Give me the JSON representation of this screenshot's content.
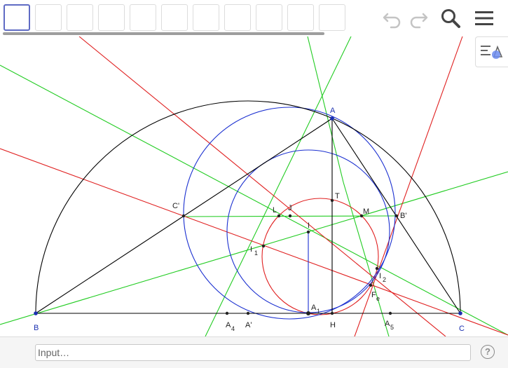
{
  "toolbar": {
    "tool_count": 11,
    "icons": [
      "undo-icon",
      "redo-icon",
      "search-icon",
      "menu-icon"
    ]
  },
  "style_bar": {
    "icon": "style-bar-icon"
  },
  "colors": {
    "black_lines": "#000000",
    "blue_circles": "#1a2fd0",
    "red_lines": "#e02020",
    "green_lines": "#22cc22",
    "point_labels_blue": "#1a2fb0",
    "tool_selected_border": "#5f6bc4"
  },
  "canvas": {
    "point_labels": {
      "A": "A",
      "B": "B",
      "C": "C",
      "C_prime": "C'",
      "B_prime": "B'",
      "A_prime": "A'",
      "L": "L",
      "J": "J",
      "M": "M",
      "T": "T",
      "I": "I",
      "I1": "I",
      "I1_sub": "1",
      "I2": "I",
      "I2_sub": "2",
      "Fe": "F",
      "Fe_sub": "e",
      "A1": "A",
      "A1_sub": "1",
      "A4": "A",
      "A4_sub": "4",
      "A5": "A",
      "A5_sub": "5",
      "H": "H"
    }
  },
  "input_bar": {
    "placeholder": "Input…",
    "help_label": "?"
  }
}
